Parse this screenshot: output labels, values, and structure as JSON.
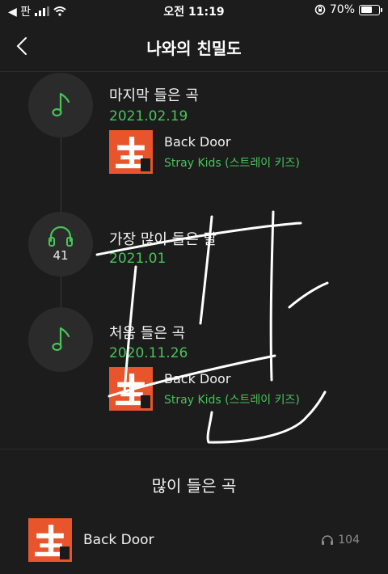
{
  "status_bar": {
    "carrier": "◀ 판",
    "time": "오전 11:19",
    "battery": "70%",
    "battery_level": 0.7
  },
  "header": {
    "title": "나와의 친밀도"
  },
  "timeline": {
    "last_played": {
      "label": "마지막 들은 곡",
      "date": "2021.02.19",
      "song": {
        "title": "Back Door",
        "artist": "Stray Kids (스트레이 키즈)"
      }
    },
    "most_played_month": {
      "label": "가장 많이 들은 달",
      "date": "2021.01",
      "count": "41"
    },
    "first_played": {
      "label": "처음 들은 곡",
      "date": "2020.11.26",
      "song": {
        "title": "Back Door",
        "artist": "Stray Kids (스트레이 키즈)"
      }
    }
  },
  "most_played": {
    "section_title": "많이 들은 곡",
    "items": [
      {
        "title": "Back Door",
        "plays": "104"
      }
    ]
  },
  "colors": {
    "background": "#1c1c1c",
    "accent": "#47c45a",
    "circle": "#2b2b2b"
  }
}
